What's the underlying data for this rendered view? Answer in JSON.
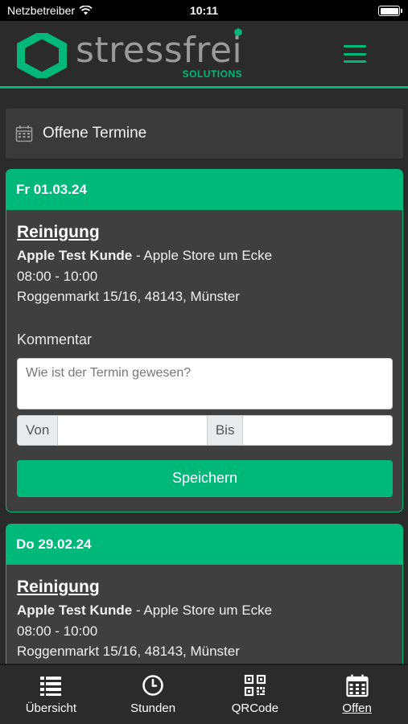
{
  "status_bar": {
    "carrier": "Netzbetreiber",
    "time": "10:11"
  },
  "header": {
    "logo_word": "stressfrei",
    "logo_sub": "SOLUTIONS",
    "accent_color": "#00b87a"
  },
  "section": {
    "title": "Offene Termine",
    "icon": "calendar-icon"
  },
  "appointments": [
    {
      "date": "Fr 01.03.24",
      "service": "Reinigung",
      "customer": "Apple Test Kunde",
      "location_sep": " - ",
      "location": "Apple Store um Ecke",
      "time": "08:00 - 10:00",
      "address": "Roggenmarkt 15/16, 48143, Münster",
      "comment_label": "Kommentar",
      "comment_placeholder": "Wie ist der Termin gewesen?",
      "from_label": "Von",
      "to_label": "Bis",
      "save_label": "Speichern"
    },
    {
      "date": "Do 29.02.24",
      "service": "Reinigung",
      "customer": "Apple Test Kunde",
      "location_sep": " - ",
      "location": "Apple Store um Ecke",
      "time": "08:00 - 10:00",
      "address": "Roggenmarkt 15/16, 48143, Münster"
    }
  ],
  "bottom_nav": [
    {
      "label": "Übersicht",
      "icon": "list-icon"
    },
    {
      "label": "Stunden",
      "icon": "clock-icon"
    },
    {
      "label": "QRCode",
      "icon": "qrcode-icon"
    },
    {
      "label": "Offen",
      "icon": "calendar-icon",
      "active": true
    }
  ]
}
